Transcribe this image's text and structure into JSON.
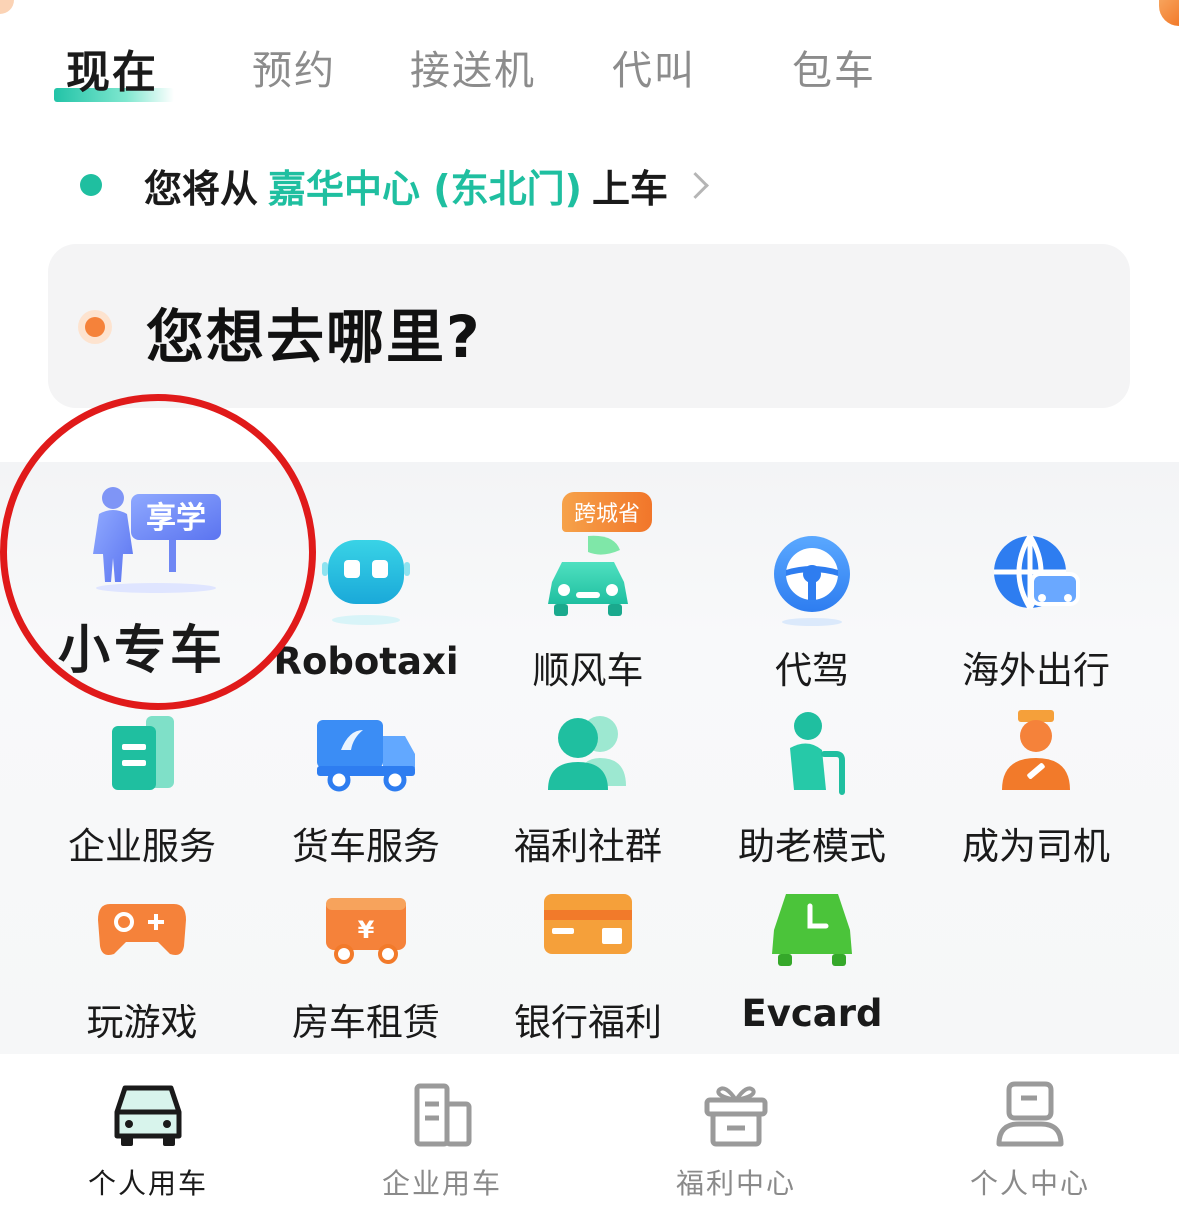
{
  "top_tabs": [
    {
      "label": "现在",
      "active": true
    },
    {
      "label": "预约",
      "active": false
    },
    {
      "label": "接送机",
      "active": false
    },
    {
      "label": "代叫",
      "active": false
    },
    {
      "label": "包车",
      "active": false
    }
  ],
  "pickup": {
    "prefix": "您将从",
    "place": "嘉华中心 (东北门)",
    "suffix": "上车"
  },
  "destination": {
    "placeholder": "您想去哪里?"
  },
  "services": [
    {
      "label": "小专车",
      "icon": "tutor-sign-icon",
      "sign_text": "享学",
      "highlighted": true
    },
    {
      "label": "Robotaxi",
      "icon": "robot-icon"
    },
    {
      "label": "顺风车",
      "icon": "green-leaf-car-icon",
      "badge": "跨城省"
    },
    {
      "label": "代驾",
      "icon": "steering-wheel-icon"
    },
    {
      "label": "海外出行",
      "icon": "globe-car-icon"
    },
    {
      "label": "企业服务",
      "icon": "building-doc-icon"
    },
    {
      "label": "货车服务",
      "icon": "truck-icon"
    },
    {
      "label": "福利社群",
      "icon": "people-group-icon"
    },
    {
      "label": "助老模式",
      "icon": "elder-cane-icon"
    },
    {
      "label": "成为司机",
      "icon": "driver-icon"
    },
    {
      "label": "玩游戏",
      "icon": "gamepad-icon"
    },
    {
      "label": "房车租赁",
      "icon": "rv-icon",
      "glyph": "¥"
    },
    {
      "label": "银行福利",
      "icon": "bank-card-icon"
    },
    {
      "label": "Evcard",
      "icon": "ev-car-clock-icon"
    }
  ],
  "bottom_nav": [
    {
      "label": "个人用车",
      "icon": "car-icon",
      "active": true
    },
    {
      "label": "企业用车",
      "icon": "building-icon",
      "active": false
    },
    {
      "label": "福利中心",
      "icon": "gift-icon",
      "active": false
    },
    {
      "label": "个人中心",
      "icon": "user-icon",
      "active": false
    }
  ],
  "colors": {
    "accent_green": "#1fbfa0",
    "accent_orange": "#f5823a",
    "highlight_red": "#e01a1a"
  }
}
